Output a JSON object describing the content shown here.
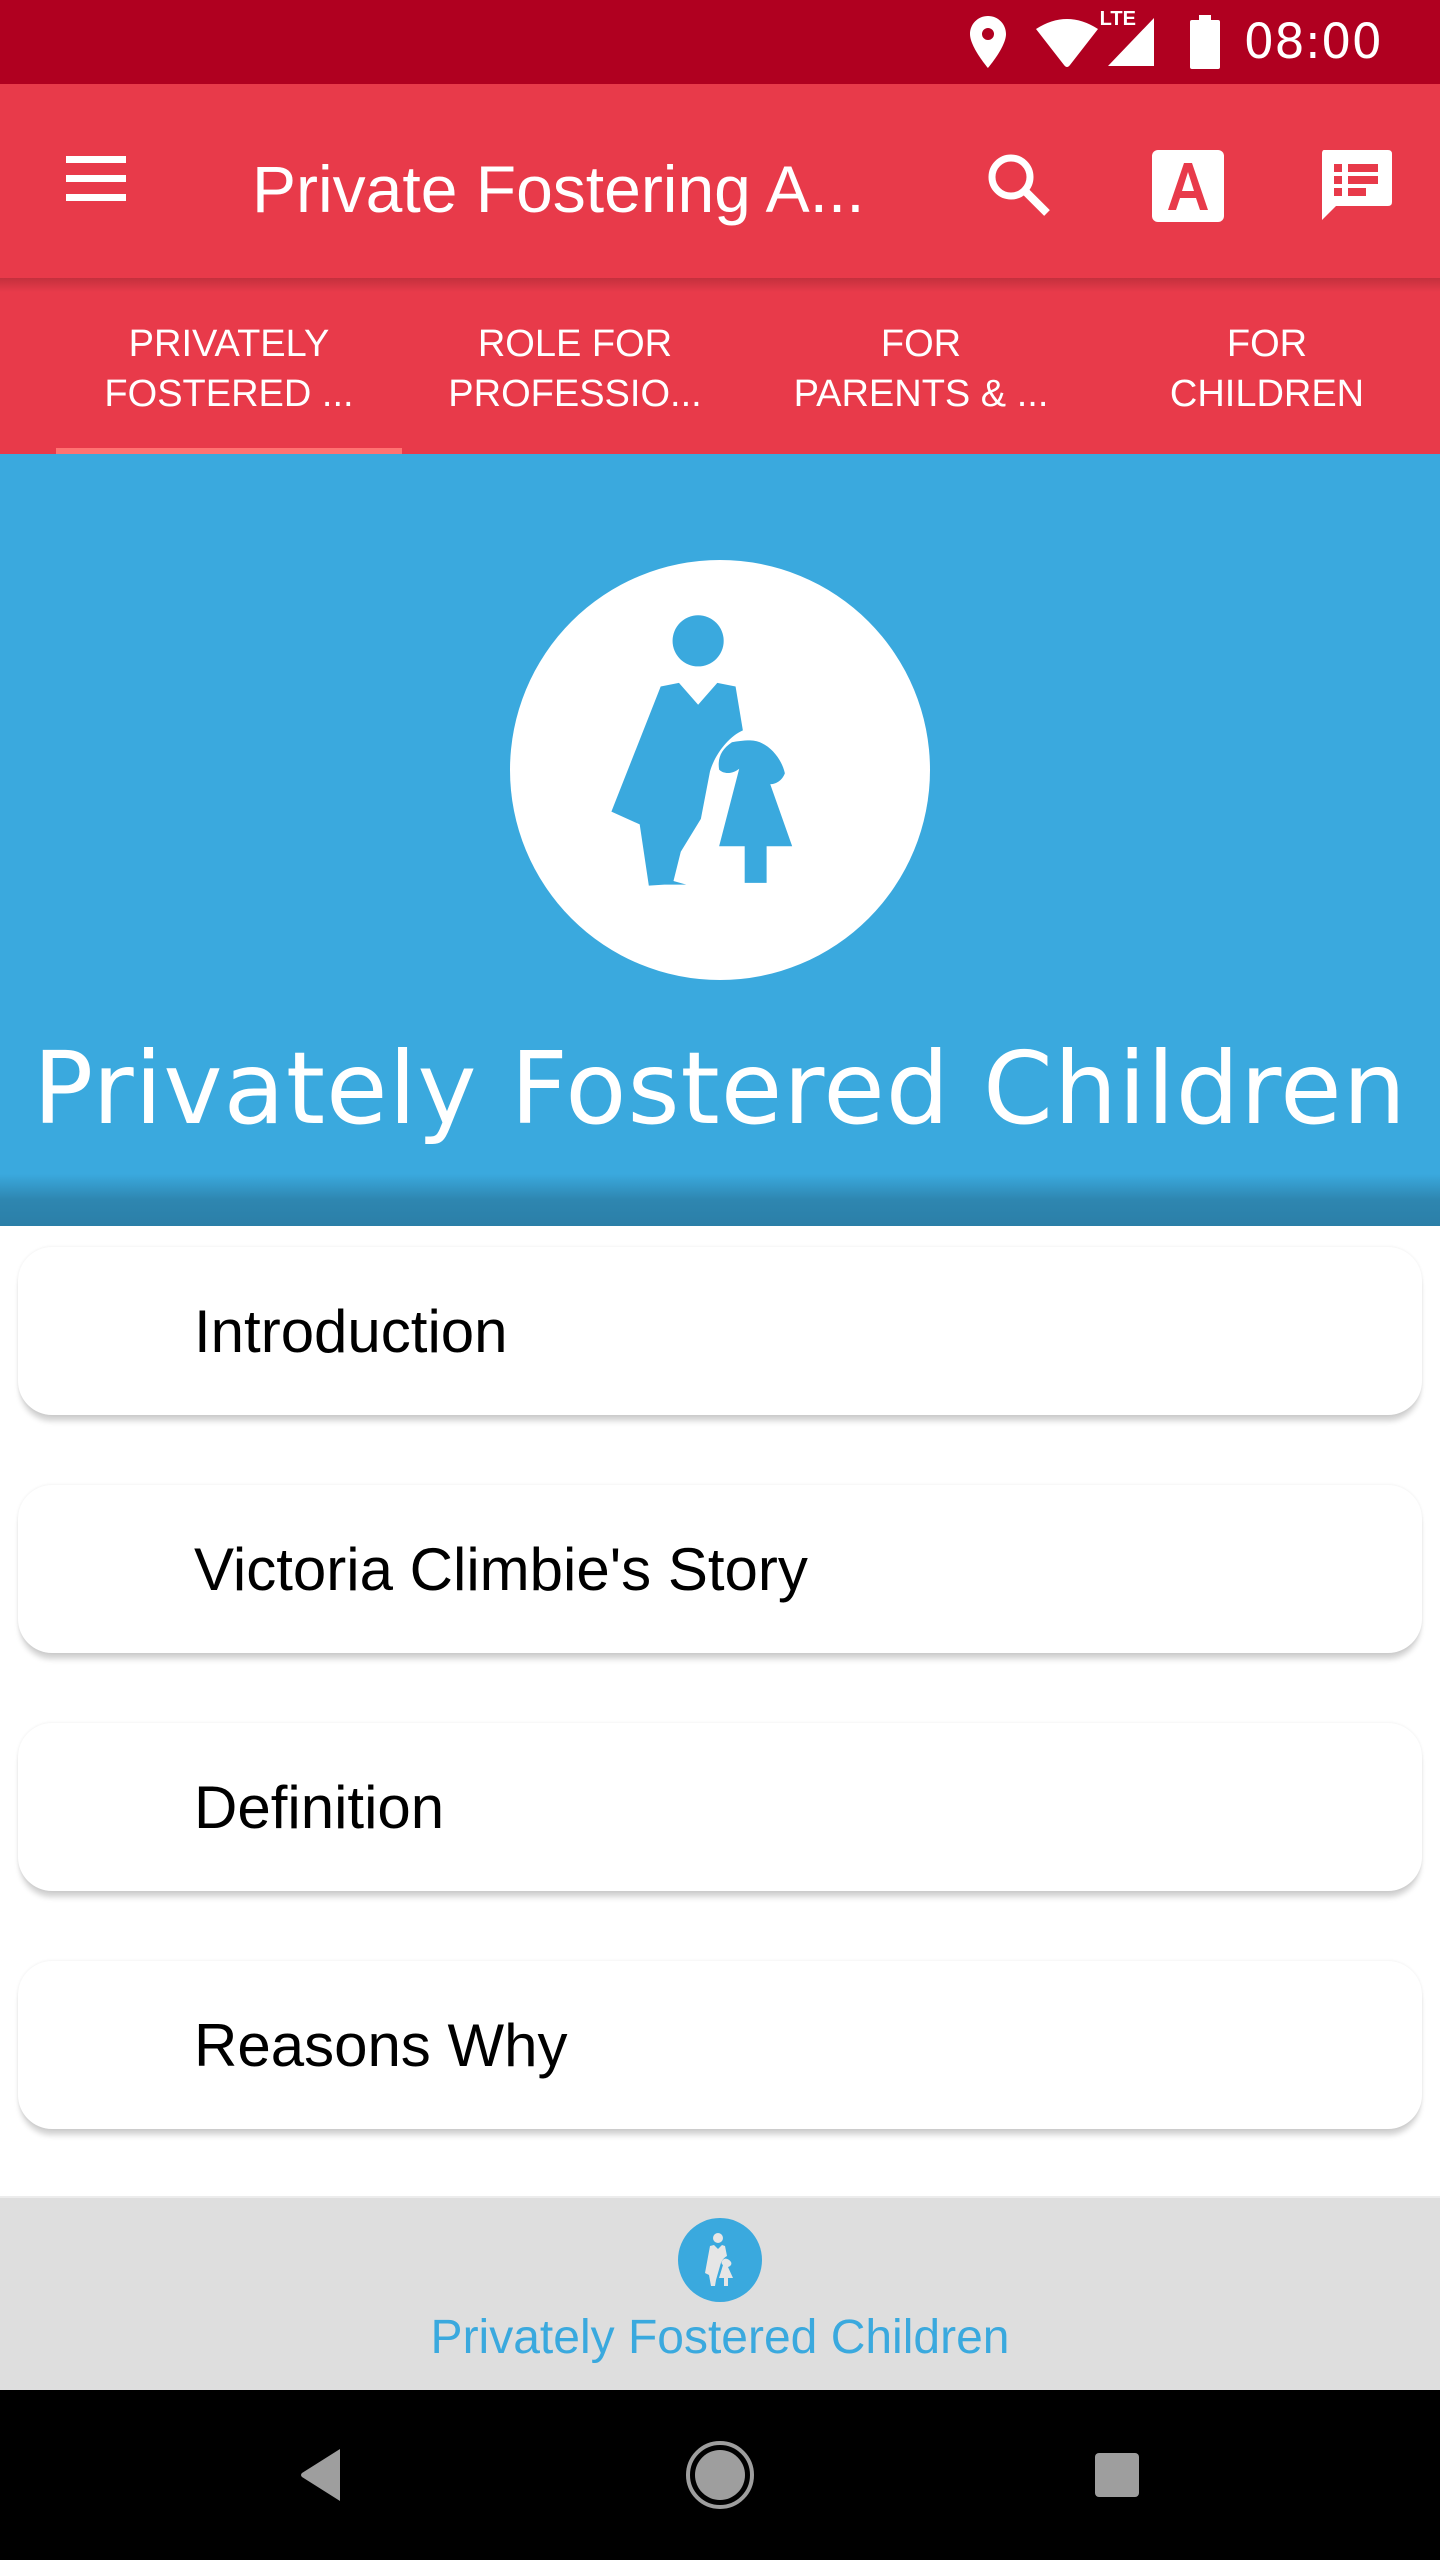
{
  "status_bar": {
    "time": "08:00",
    "network_label": "LTE",
    "icons": [
      "location-icon",
      "wifi-icon",
      "lte-signal-icon",
      "battery-icon"
    ]
  },
  "toolbar": {
    "title": "Private Fostering A...",
    "menu_icon": "hamburger-menu-icon",
    "actions": [
      {
        "name": "search",
        "icon": "search-icon"
      },
      {
        "name": "font-size",
        "icon": "font-size-icon",
        "glyph": "A"
      },
      {
        "name": "feedback",
        "icon": "feedback-icon"
      }
    ]
  },
  "tabs": [
    {
      "label": "Privately\nFostered ...",
      "selected": true
    },
    {
      "label": "Role for\nProfessio...",
      "selected": false
    },
    {
      "label": "For\nParents & ...",
      "selected": false
    },
    {
      "label": "For\nChildren",
      "selected": false
    }
  ],
  "hero": {
    "icon": "mother-and-child-icon",
    "title": "Privately Fostered Children"
  },
  "sections": [
    {
      "label": "Introduction"
    },
    {
      "label": "Victoria Climbie's Story"
    },
    {
      "label": "Definition"
    },
    {
      "label": "Reasons Why"
    }
  ],
  "bottom_nav": {
    "items": [
      {
        "label": "Privately Fostered Children",
        "icon": "mother-and-child-icon",
        "selected": true
      }
    ]
  },
  "system_nav": {
    "buttons": [
      "back",
      "home",
      "recents"
    ]
  },
  "colors": {
    "status_bar": "#B00020",
    "primary": "#E83A4A",
    "tab_indicator": "#FF7272",
    "accent_blue": "#3AA9DE",
    "bottom_nav_bg": "#DEDEDE"
  }
}
